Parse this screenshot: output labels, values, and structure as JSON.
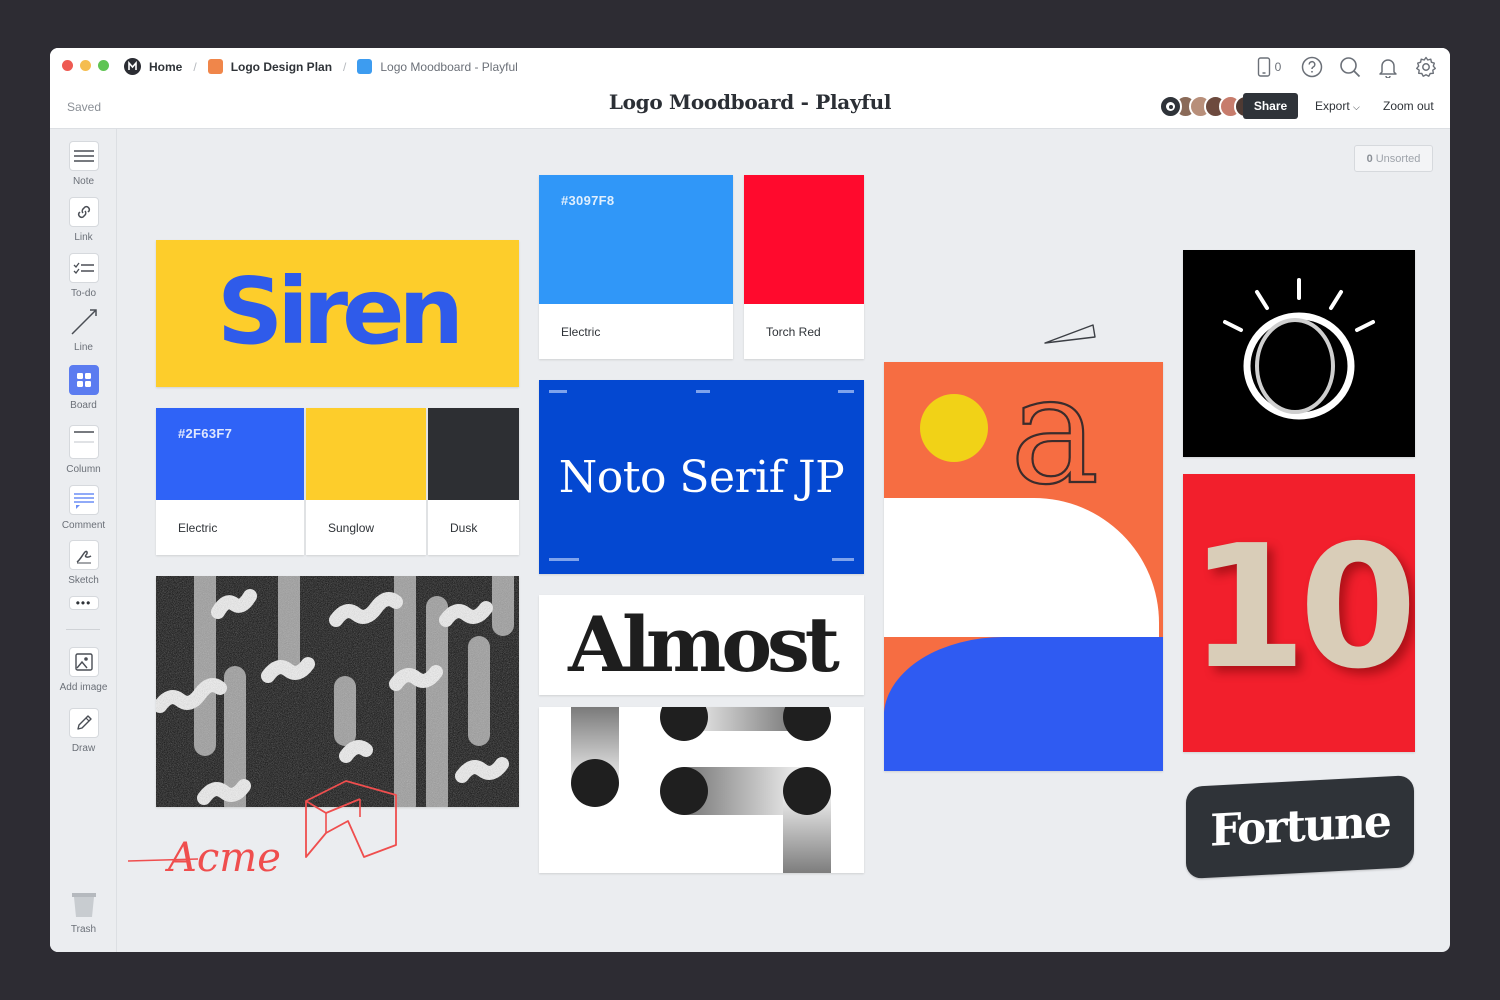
{
  "window": {
    "dot_colors": [
      "#ee5a52",
      "#f5bd4f",
      "#5fc453"
    ],
    "breadcrumbs": [
      {
        "label": "Home",
        "color": "#2b2d33"
      },
      {
        "label": "Logo Design Plan",
        "color": "#f0864a"
      },
      {
        "label": "Logo Moodboard - Playful",
        "color": "#3d9cf0"
      }
    ],
    "saved_status": "Saved",
    "title": "Logo Moodboard - Playful",
    "device_count": "0",
    "share_label": "Share",
    "export_label": "Export",
    "zoom_label": "Zoom out"
  },
  "sidebar": {
    "tools": [
      {
        "label": "Note",
        "icon": "note-icon"
      },
      {
        "label": "Link",
        "icon": "link-icon"
      },
      {
        "label": "To-do",
        "icon": "todo-icon"
      },
      {
        "label": "Line",
        "icon": "line-icon"
      },
      {
        "label": "Board",
        "icon": "board-icon"
      },
      {
        "label": "Column",
        "icon": "column-icon"
      },
      {
        "label": "Comment",
        "icon": "comment-icon"
      },
      {
        "label": "Sketch",
        "icon": "sketch-icon"
      },
      {
        "label": "Add image",
        "icon": "image-icon"
      },
      {
        "label": "Draw",
        "icon": "pencil-icon"
      },
      {
        "label": "Trash",
        "icon": "trash-icon"
      }
    ]
  },
  "canvas": {
    "unsorted_count": "0",
    "unsorted_label": "Unsorted",
    "siren_text": "Siren",
    "swatches_row1": [
      {
        "hex": "#2F63F7",
        "name": "Electric",
        "color": "#2f63f7"
      },
      {
        "hex": "",
        "name": "Sunglow",
        "color": "#fdcd2b"
      },
      {
        "hex": "",
        "name": "Dusk",
        "color": "#2d2f33"
      }
    ],
    "swatches_row2": [
      {
        "hex": "#3097F8",
        "name": "Electric",
        "color": "#3097f8"
      },
      {
        "hex": "",
        "name": "Torch Red",
        "color": "#ff0a2d"
      }
    ],
    "noto_text": "Noto Serif JP",
    "almost_text": "Almost",
    "acme_text": "Acme",
    "letter_a": "a",
    "ten_text": "10",
    "fortune_text": "Fortune"
  }
}
